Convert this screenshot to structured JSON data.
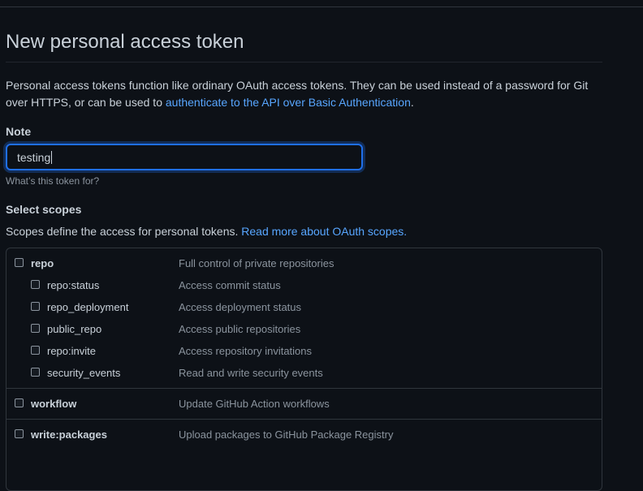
{
  "page": {
    "title": "New personal access token",
    "intro_text": "Personal access tokens function like ordinary OAuth access tokens. They can be used instead of a password for Git over HTTPS, or can be used to ",
    "intro_link": "authenticate to the API over Basic Authentication",
    "intro_end": "."
  },
  "note": {
    "label": "Note",
    "value": "testing",
    "hint": "What’s this token for?"
  },
  "scopes": {
    "label": "Select scopes",
    "desc_text": "Scopes define the access for personal tokens. ",
    "desc_link": "Read more about OAuth scopes.",
    "items": [
      {
        "name": "repo",
        "desc": "Full control of private repositories",
        "checked": false
      },
      {
        "name": "repo:status",
        "desc": "Access commit status",
        "checked": false
      },
      {
        "name": "repo_deployment",
        "desc": "Access deployment status",
        "checked": false
      },
      {
        "name": "public_repo",
        "desc": "Access public repositories",
        "checked": false
      },
      {
        "name": "repo:invite",
        "desc": "Access repository invitations",
        "checked": false
      },
      {
        "name": "security_events",
        "desc": "Read and write security events",
        "checked": false
      },
      {
        "name": "workflow",
        "desc": "Update GitHub Action workflows",
        "checked": false
      },
      {
        "name": "write:packages",
        "desc": "Upload packages to GitHub Package Registry",
        "checked": false
      }
    ]
  },
  "colors": {
    "background": "#0d1117",
    "text": "#c9d1d9",
    "link": "#58a6ff",
    "muted": "#8b949e",
    "focus_border": "#1f6feb"
  }
}
